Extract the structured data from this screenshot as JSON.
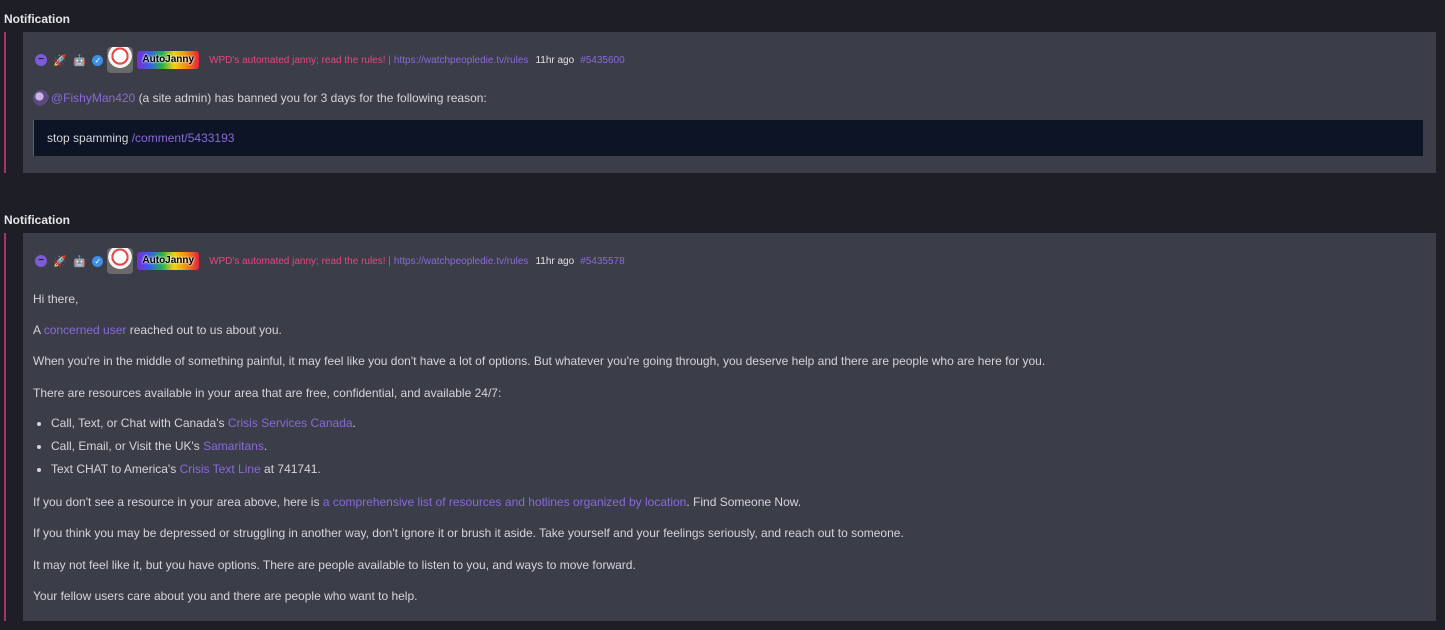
{
  "notifications": [
    {
      "heading": "Notification",
      "meta": {
        "icons": [
          "minus-circle-icon",
          "rocket-icon",
          "robot-icon",
          "verified-icon"
        ],
        "username": "AutoJanny",
        "flair": "WPD's automated janny; read the rules! |",
        "rules_link": "https://watchpeopledie.tv/rules",
        "time": "11hr ago",
        "comment_id": "#5435600"
      },
      "body": {
        "mention": "@FishyMan420",
        "text": "(a site admin) has banned you for 3 days for the following reason:",
        "quote_text": "stop spamming",
        "quote_link": "/comment/5433193"
      }
    },
    {
      "heading": "Notification",
      "meta": {
        "icons": [
          "minus-circle-icon",
          "rocket-icon",
          "robot-icon",
          "verified-icon"
        ],
        "username": "AutoJanny",
        "flair": "WPD's automated janny; read the rules! |",
        "rules_link": "https://watchpeopledie.tv/rules",
        "time": "11hr ago",
        "comment_id": "#5435578"
      },
      "body": {
        "greeting": "Hi there,",
        "p1_pre": "A",
        "p1_link": "concerned user",
        "p1_post": "reached out to us about you.",
        "p2": "When you're in the middle of something painful, it may feel like you don't have a lot of options. But whatever you're going through, you deserve help and there are people who are here for you.",
        "p3": "There are resources available in your area that are free, confidential, and available 24/7:",
        "resources": [
          {
            "pre": "Call, Text, or Chat with Canada's",
            "link": "Crisis Services Canada",
            "post": "."
          },
          {
            "pre": "Call, Email, or Visit the UK's",
            "link": "Samaritans",
            "post": "."
          },
          {
            "pre": "Text CHAT to America's",
            "link": "Crisis Text Line",
            "post": "at 741741."
          }
        ],
        "p4_pre": "If you don't see a resource in your area above, here is",
        "p4_link": "a comprehensive list of resources and hotlines organized by location",
        "p4_post": ". Find Someone Now.",
        "p5": "If you think you may be depressed or struggling in another way, don't ignore it or brush it aside. Take yourself and your feelings seriously, and reach out to someone.",
        "p6": "It may not feel like it, but you have options. There are people available to listen to you, and ways to move forward.",
        "p7": "Your fellow users care about you and there are people who want to help."
      }
    }
  ]
}
